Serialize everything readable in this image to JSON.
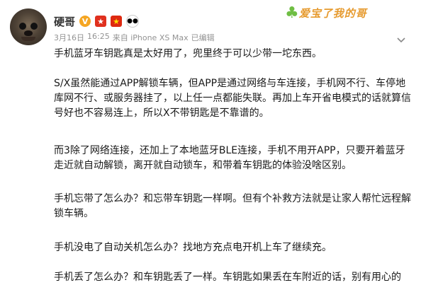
{
  "post": {
    "author": {
      "name": "硬哥",
      "badges": [
        "verified-v",
        "medal",
        "china-flag",
        "panda"
      ]
    },
    "meta": {
      "date": "3月16日",
      "time": "16:25",
      "source": "来自 iPhone XS Max",
      "edited": "已编辑"
    },
    "banner": {
      "text": "爱宝了我的哥"
    },
    "paragraphs": [
      "手机蓝牙车钥匙真是太好用了，兜里终于可以少带一坨东西。",
      "S/X虽然能通过APP解锁车辆，但APP是通过网络与车连接，手机网不行、车停地库网不行、或服务器挂了，以上任一点都能失联。再加上车开省电模式的话就算信号好也不容易连上，所以X不带钥匙是不靠谱的。",
      "而3除了网络连接，还加上了本地蓝牙BLE连接，手机不用开APP，只要开着蓝牙走近就自动解锁，离开就自动锁车，和带着车钥匙的体验没啥区别。",
      "手机忘带了怎么办？和忘带车钥匙一样啊。但有个补救方法就是让家人帮忙远程解锁车辆。",
      "手机没电了自动关机怎么办？找地方充点电开机上车了继续充。",
      "手机丢了怎么办？和车钥匙丢了一样。车钥匙如果丢在车附近的话，别有用心的"
    ]
  },
  "icons": {
    "chevron": "chevron-down-icon"
  }
}
